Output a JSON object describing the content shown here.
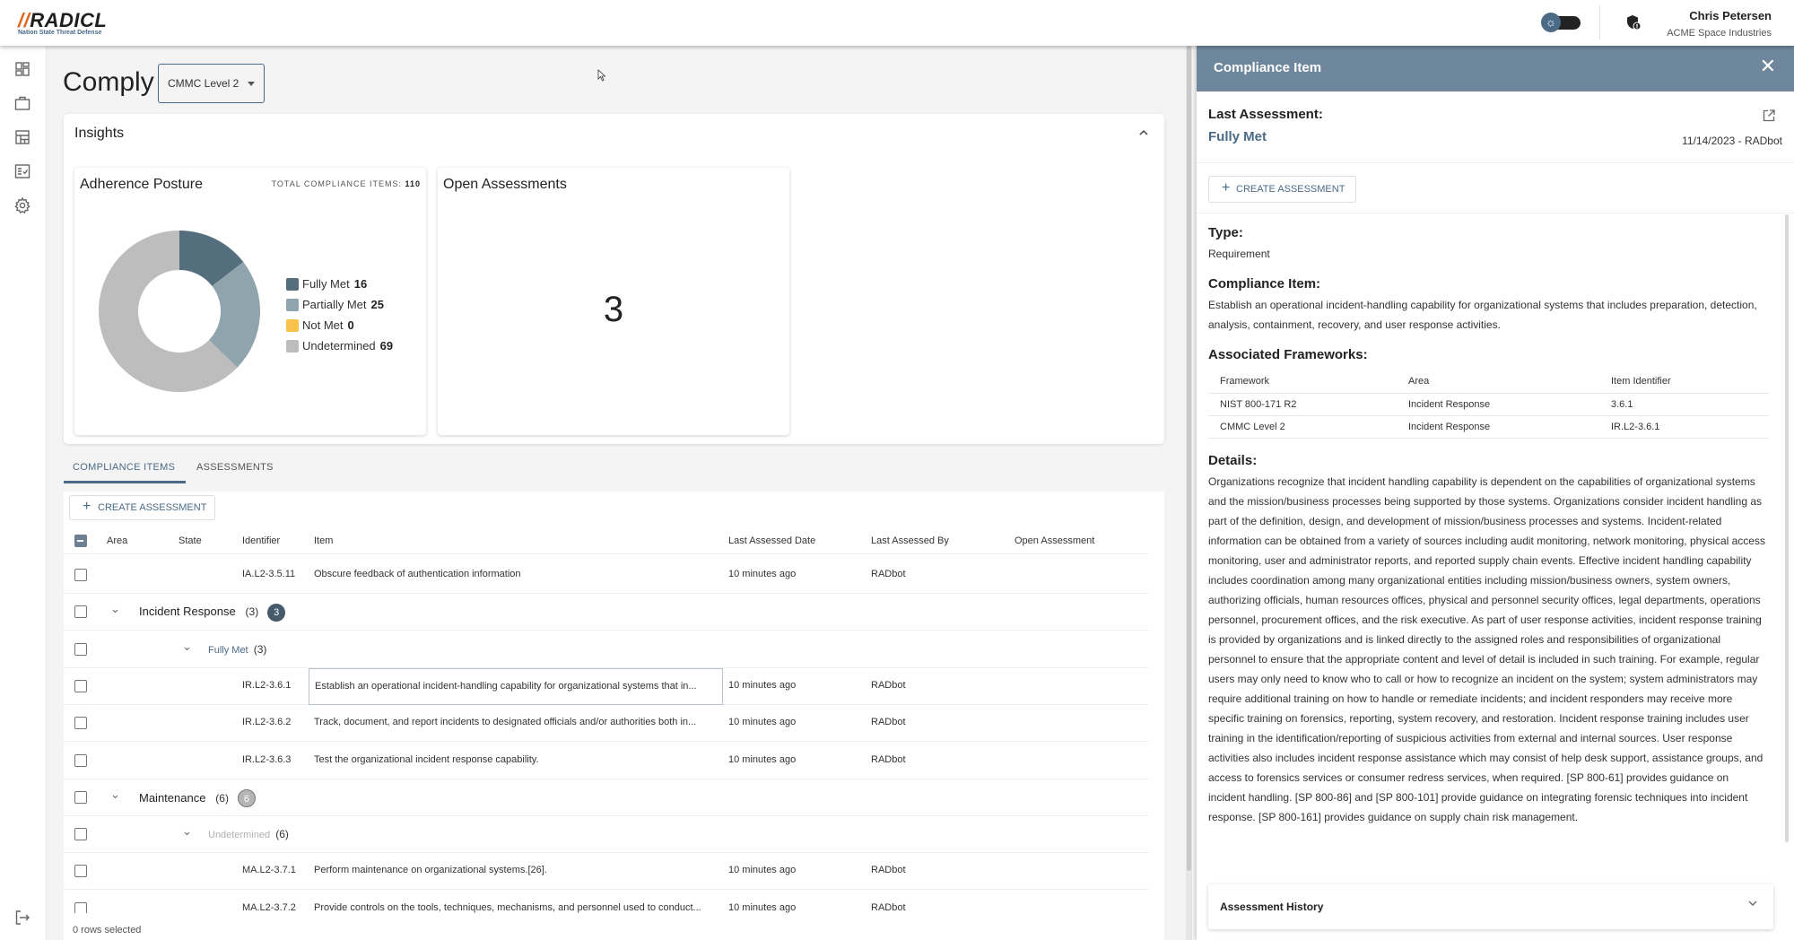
{
  "header": {
    "logo_text": "RADICL",
    "logo_tagline": "Nation State Threat Defense",
    "theme_toggle_icon": "sun-icon",
    "notification_icon": "shield-alert-icon",
    "user_name": "Chris Petersen",
    "user_org": "ACME Space Industries"
  },
  "sidebar": {
    "items": [
      {
        "name": "dashboard",
        "icon": "dashboard-icon"
      },
      {
        "name": "portfolio",
        "icon": "briefcase-icon"
      },
      {
        "name": "layout",
        "icon": "table-layout-icon"
      },
      {
        "name": "comply",
        "icon": "checklist-icon"
      },
      {
        "name": "settings",
        "icon": "gear-icon"
      }
    ],
    "logout_icon": "logout-icon"
  },
  "page": {
    "title": "Comply",
    "framework_select": "CMMC Level 2"
  },
  "insights": {
    "title": "Insights",
    "adherence": {
      "title": "Adherence Posture",
      "total_label": "TOTAL COMPLIANCE ITEMS:",
      "total_value": "110"
    },
    "open_assessments": {
      "title": "Open Assessments",
      "count": "3"
    }
  },
  "chart_data": {
    "type": "pie",
    "title": "Adherence Posture",
    "categories": [
      "Fully Met",
      "Partially Met",
      "Not Met",
      "Undetermined"
    ],
    "values": [
      16,
      25,
      0,
      69
    ],
    "colors": [
      "#546e7e",
      "#90a4ae",
      "#f9c24a",
      "#bdbdbd"
    ],
    "legend": "right",
    "donut": true
  },
  "tabs": [
    {
      "label": "COMPLIANCE ITEMS",
      "active": true
    },
    {
      "label": "ASSESSMENTS",
      "active": false
    }
  ],
  "table": {
    "create_label": "CREATE ASSESSMENT",
    "columns": [
      "Area",
      "State",
      "Identifier",
      "Item",
      "Last Assessed Date",
      "Last Assessed By",
      "Open Assessment"
    ],
    "rows": [
      {
        "type": "item",
        "identifier": "IA.L2-3.5.11",
        "item": "Obscure feedback of authentication information",
        "date": "10 minutes ago",
        "by": "RADbot"
      },
      {
        "type": "group",
        "area": "Incident Response",
        "count": "(3)",
        "badge": "3",
        "badge_color": "#455a6b"
      },
      {
        "type": "state",
        "state": "Fully Met",
        "count": "(3)",
        "state_color": "#4a6a86"
      },
      {
        "type": "item",
        "identifier": "IR.L2-3.6.1",
        "item": "Establish an operational incident-handling capability for organizational systems that in...",
        "date": "10 minutes ago",
        "by": "RADbot",
        "focused": true
      },
      {
        "type": "item",
        "identifier": "IR.L2-3.6.2",
        "item": "Track, document, and report incidents to designated officials and/or authorities both in...",
        "date": "10 minutes ago",
        "by": "RADbot"
      },
      {
        "type": "item",
        "identifier": "IR.L2-3.6.3",
        "item": "Test the organizational incident response capability.",
        "date": "10 minutes ago",
        "by": "RADbot"
      },
      {
        "type": "group",
        "area": "Maintenance",
        "count": "(6)",
        "badge": "6",
        "badge_color": "#b5b5b5"
      },
      {
        "type": "state",
        "state": "Undetermined",
        "count": "(6)",
        "state_color": "#b0b0b0"
      },
      {
        "type": "item",
        "identifier": "MA.L2-3.7.1",
        "item": "Perform maintenance on organizational systems.[26].",
        "date": "10 minutes ago",
        "by": "RADbot"
      },
      {
        "type": "item",
        "identifier": "MA.L2-3.7.2",
        "item": "Provide controls on the tools, techniques, mechanisms, and personnel used to conduct...",
        "date": "10 minutes ago",
        "by": "RADbot"
      }
    ],
    "footer": "0 rows selected"
  },
  "panel": {
    "title": "Compliance Item",
    "last_assessment_label": "Last Assessment:",
    "last_assessment_value": "Fully Met",
    "last_assessment_meta": "11/14/2023 - RADbot",
    "create_label": "CREATE ASSESSMENT",
    "type_label": "Type:",
    "type_value": "Requirement",
    "item_label": "Compliance Item:",
    "item_value": "Establish an operational incident-handling capability for organizational systems that includes preparation, detection, analysis, containment, recovery, and user response activities.",
    "frameworks_label": "Associated Frameworks:",
    "frameworks_columns": [
      "Framework",
      "Area",
      "Item Identifier"
    ],
    "frameworks": [
      {
        "framework": "NIST 800-171 R2",
        "area": "Incident Response",
        "identifier": "3.6.1"
      },
      {
        "framework": "CMMC Level 2",
        "area": "Incident Response",
        "identifier": "IR.L2-3.6.1"
      }
    ],
    "details_label": "Details:",
    "details_value": "Organizations recognize that incident handling capability is dependent on the capabilities of organizational systems and the mission/business processes being supported by those systems. Organizations consider incident handling as part of the definition, design, and development of mission/business processes and systems. Incident-related information can be obtained from a variety of sources including audit monitoring, network monitoring, physical access monitoring, user and administrator reports, and reported supply chain events. Effective incident handling capability includes coordination among many organizational entities including mission/business owners, system owners, authorizing officials, human resources offices, physical and personnel security offices, legal departments, operations personnel, procurement offices, and the risk executive.  As part of user response activities, incident response training is provided by organizations and is linked directly to the assigned roles and responsibilities of organizational personnel to ensure that the appropriate content and level of detail is included in such training. For example, regular users may only need to know who to call or how to recognize an incident on the system; system administrators may require additional training on how to handle or remediate incidents; and incident responders may receive more specific training on forensics, reporting, system recovery, and restoration. Incident response training includes user training in the identification/reporting of suspicious activities from external and internal sources. User response activities also includes incident response assistance which may consist of help desk support, assistance groups, and access to forensics services or consumer redress services, when required.  [SP 800-61] provides guidance on incident handling. [SP 800-86] and [SP 800-101] provide guidance on integrating forensic techniques into incident response. [SP 800-161] provides guidance on supply chain risk management.",
    "history_label": "Assessment History"
  }
}
